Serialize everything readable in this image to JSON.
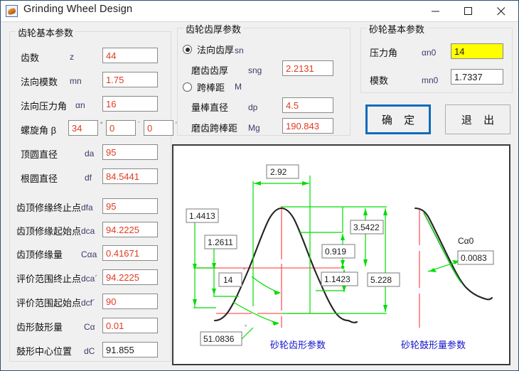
{
  "window": {
    "title": "Grinding Wheel Design",
    "icon": "app-icon",
    "minimize": "–",
    "maximize": "□",
    "close": "✕"
  },
  "gear_group": {
    "title": "齿轮基本参数",
    "rows": [
      {
        "label": "齿数",
        "symbol": "z",
        "value": "44"
      },
      {
        "label": "法向模数",
        "symbol": "mn",
        "value": "1.75"
      },
      {
        "label": "法向压力角",
        "symbol": "αn",
        "value": "16"
      },
      {
        "label": "螺旋角 β",
        "symbol": "",
        "value": "34",
        "value2": "0",
        "value3": "0"
      },
      {
        "label": "顶圆直径",
        "symbol": "da",
        "value": "95"
      },
      {
        "label": "根圆直径",
        "symbol": "df",
        "value": "84.5441"
      },
      {
        "label": "齿顶修缘终止点",
        "symbol": "dfa",
        "value": "95"
      },
      {
        "label": "齿顶修缘起始点",
        "symbol": "dca",
        "value": "94.2225"
      },
      {
        "label": "齿顶修缘量",
        "symbol": "Cαa",
        "value": "0.41671"
      },
      {
        "label": "评价范围终止点",
        "symbol": "dca´",
        "value": "94.2225"
      },
      {
        "label": "评价范围起始点",
        "symbol": "dcf´",
        "value": "90"
      },
      {
        "label": "齿形鼓形量",
        "symbol": "Cα",
        "value": "0.01"
      },
      {
        "label": "鼓形中心位置",
        "symbol": "dC",
        "value": "91.855"
      }
    ],
    "deg_marks": {
      "deg": "°",
      "min": "´",
      "sec": "″"
    }
  },
  "thickness_group": {
    "title": "齿轮齿厚参数",
    "radio1": {
      "label": "法向齿厚",
      "symbol": "sn",
      "selected": true
    },
    "radio2": {
      "label": "跨棒距",
      "symbol": "M",
      "selected": false
    },
    "rows": [
      {
        "label": "磨齿齿厚",
        "symbol": "sng",
        "value": "2.2131"
      },
      {
        "label": "量棒直径",
        "symbol": "dp",
        "value": "4.5"
      },
      {
        "label": "磨齿跨棒距",
        "symbol": "Mg",
        "value": "190.843"
      }
    ]
  },
  "wheel_group": {
    "title": "砂轮基本参数",
    "rows": [
      {
        "label": "压力角",
        "symbol": "αn0",
        "value": "14",
        "highlight": true
      },
      {
        "label": "模数",
        "symbol": "mn0",
        "value": "1.7337",
        "highlight": false
      }
    ]
  },
  "buttons": {
    "ok": "确 定",
    "exit": "退 出"
  },
  "diagram": {
    "captions": {
      "left": "砂轮齿形参数",
      "right": "砂轮鼓形量参数"
    },
    "labels": {
      "top_width": "2.92",
      "left_outer": "1.4413",
      "left_inner": "1.2611",
      "angle_top": "14",
      "angle_bottom": "51.0836",
      "right_upper": "3.5422",
      "right_mid": "0.919",
      "right_lower": "1.1423",
      "right_total": "5.228",
      "crown_symbol": "Cα0",
      "crown_value": "0.0083"
    }
  },
  "colors": {
    "accent": "#0f6bbd",
    "value_text": "#e03b20",
    "highlight": "#ffff00",
    "dimension_green": "#00dd00",
    "center_red": "#ff3b3b",
    "caption_blue": "#1414cc"
  }
}
